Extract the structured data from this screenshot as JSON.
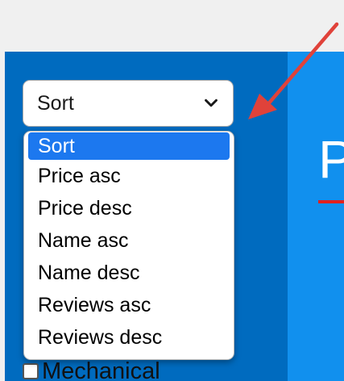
{
  "colors": {
    "sidebar": "#006bbf",
    "main": "#1190ee",
    "top_bar": "#f0f0f0",
    "selected_option": "#1c78ef",
    "annotation_arrow": "#e0423a"
  },
  "main": {
    "heading_fragment": "P"
  },
  "sort": {
    "selected_label": "Sort",
    "chevron_icon": "chevron-down-icon",
    "options": [
      {
        "label": "Sort",
        "selected": true
      },
      {
        "label": "Price asc"
      },
      {
        "label": "Price desc"
      },
      {
        "label": "Name asc"
      },
      {
        "label": "Name desc"
      },
      {
        "label": "Reviews asc"
      },
      {
        "label": "Reviews desc"
      }
    ]
  },
  "filters": {
    "visible_item": {
      "label": "Mechanical",
      "checked": false
    }
  },
  "annotation": {
    "icon": "red-arrow-icon"
  }
}
